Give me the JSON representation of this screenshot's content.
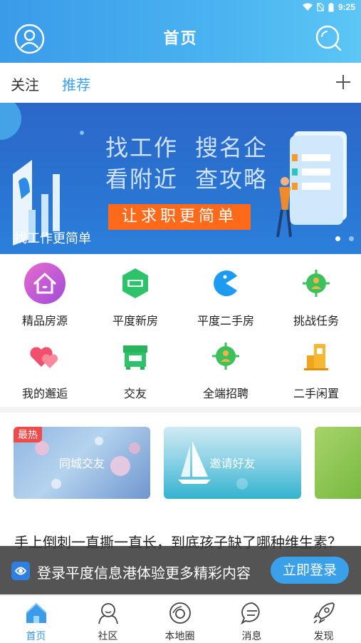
{
  "status": {
    "time": "9:25"
  },
  "header": {
    "title": "首页"
  },
  "tabs": [
    {
      "label": "关注"
    },
    {
      "label": "推荐"
    }
  ],
  "banner": {
    "lines": [
      "找工作",
      "搜名企",
      "看附近",
      "查攻略"
    ],
    "cta": "让求职更简单",
    "caption": "找工作更简单",
    "page_count": 2,
    "active_page": 1
  },
  "grid": [
    {
      "label": "精品房源",
      "icon": "house-icon"
    },
    {
      "label": "平度新房",
      "icon": "category-hex-icon"
    },
    {
      "label": "平度二手房",
      "icon": "pacman-icon"
    },
    {
      "label": "挑战任务",
      "icon": "target-person-icon"
    },
    {
      "label": "我的邂逅",
      "icon": "hearts-icon"
    },
    {
      "label": "交友",
      "icon": "shop-icon"
    },
    {
      "label": "全端招聘",
      "icon": "target-person-icon"
    },
    {
      "label": "二手闲置",
      "icon": "building-icon"
    }
  ],
  "cards": [
    {
      "title": "同城交友",
      "badge": "最热"
    },
    {
      "title": "邀请好友"
    }
  ],
  "article": {
    "title": "手上倒刺一直撕一直长，到底孩子缺了哪种维生素？"
  },
  "login_bar": {
    "text": "登录平度信息港体验更多精彩内容",
    "button": "立即登录"
  },
  "nav": [
    {
      "label": "首页",
      "icon": "home-icon"
    },
    {
      "label": "社区",
      "icon": "community-icon"
    },
    {
      "label": "本地圈",
      "icon": "local-circle-icon"
    },
    {
      "label": "消息",
      "icon": "message-icon"
    },
    {
      "label": "发现",
      "icon": "rocket-icon"
    }
  ],
  "colors": {
    "accent": "#3a9be9",
    "cta_orange": "#ff6a1a",
    "hot_red": "#f04a4a"
  }
}
